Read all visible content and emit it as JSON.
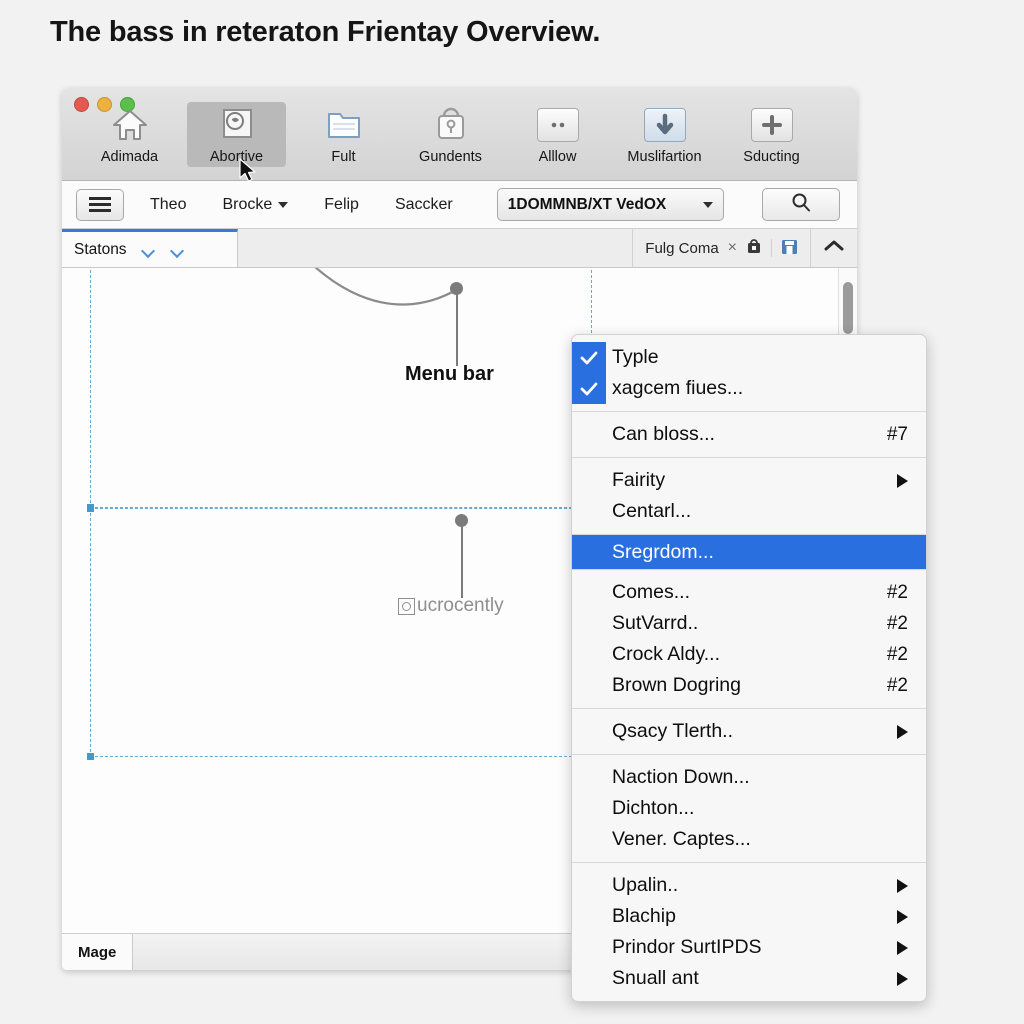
{
  "page": {
    "title": "The bass in reteraton Frientay Overview."
  },
  "window": {
    "traffic_lights": [
      "close-red",
      "minimize-yellow",
      "zoom-green"
    ],
    "toolbar": {
      "items": [
        {
          "label": "Adimada",
          "icon": "home-icon",
          "selected": false
        },
        {
          "label": "Abortive",
          "icon": "stamp-icon",
          "selected": true
        },
        {
          "label": "Fult",
          "icon": "folder-icon",
          "selected": false
        },
        {
          "label": "Gundents",
          "icon": "bag-lock-icon",
          "selected": false
        },
        {
          "label": "Alllow",
          "icon": "dots-icon",
          "selected": false
        },
        {
          "label": "Muslifartion",
          "icon": "download-icon",
          "selected": false
        },
        {
          "label": "Sducting",
          "icon": "plus-icon",
          "selected": false
        }
      ]
    },
    "menustrip": {
      "hamburger": "list-icon",
      "items": [
        {
          "label": "Theo",
          "has_dropdown": false
        },
        {
          "label": "Brocke",
          "has_dropdown": true
        },
        {
          "label": "Felip",
          "has_dropdown": false
        },
        {
          "label": "Saccker",
          "has_dropdown": false
        }
      ],
      "combo_value": "1DOMMNB/XT VedOX",
      "search_icon": "search-icon"
    },
    "tabstrip": {
      "active_tab": "Statons",
      "right_label": "Fulg Coma",
      "close_glyph": "×",
      "bag_icon": "bag-icon",
      "save_icon": "save-icon",
      "collapse_icon": "chevron-up-icon"
    },
    "canvas": {
      "annotations": [
        {
          "label": "Menu bar",
          "style": "bold"
        },
        {
          "label": "ucrocently",
          "style": "muted"
        }
      ]
    },
    "statusbar": {
      "tab_label": "Mage"
    }
  },
  "context_menu": {
    "groups": [
      {
        "items": [
          {
            "label": "Typle",
            "checked": true,
            "accel": "",
            "submenu": false
          },
          {
            "label": "xagcem fiues...",
            "checked": true,
            "accel": "",
            "submenu": false
          }
        ]
      },
      {
        "items": [
          {
            "label": "Can bloss...",
            "checked": false,
            "accel": "#7",
            "submenu": false
          }
        ]
      },
      {
        "items": [
          {
            "label": "Fairity",
            "checked": false,
            "accel": "",
            "submenu": true
          },
          {
            "label": "Centarl...",
            "checked": false,
            "accel": "",
            "submenu": false
          }
        ]
      },
      {
        "items": [
          {
            "label": "Sregrdom...",
            "checked": false,
            "accel": "",
            "submenu": false,
            "highlighted": true
          }
        ]
      },
      {
        "items": [
          {
            "label": "Comes...",
            "checked": false,
            "accel": "#2",
            "submenu": false
          },
          {
            "label": "SutVarrd..",
            "checked": false,
            "accel": "#2",
            "submenu": false
          },
          {
            "label": "Crock Aldy...",
            "checked": false,
            "accel": "#2",
            "submenu": false
          },
          {
            "label": "Brown Dogring",
            "checked": false,
            "accel": "#2",
            "submenu": false
          }
        ]
      },
      {
        "items": [
          {
            "label": "Qsacy Tlerth..",
            "checked": false,
            "accel": "",
            "submenu": true
          }
        ]
      },
      {
        "items": [
          {
            "label": "Naction Down...",
            "checked": false,
            "accel": "",
            "submenu": false
          },
          {
            "label": "Dichton...",
            "checked": false,
            "accel": "",
            "submenu": false
          },
          {
            "label": "Vener. Captes...",
            "checked": false,
            "accel": "",
            "submenu": false
          }
        ]
      },
      {
        "items": [
          {
            "label": "Upalin..",
            "checked": false,
            "accel": "",
            "submenu": true
          },
          {
            "label": "Blachip",
            "checked": false,
            "accel": "",
            "submenu": true
          },
          {
            "label": "Prindor SurtIPDS",
            "checked": false,
            "accel": "",
            "submenu": true
          },
          {
            "label": "Snuall ant",
            "checked": false,
            "accel": "",
            "submenu": true
          }
        ]
      }
    ]
  },
  "colors": {
    "accent_blue": "#2a6fe0",
    "selection_dash": "#64aad4",
    "page_bg": "#f2f2f2",
    "chrome_gray": "#d3d3d3"
  }
}
